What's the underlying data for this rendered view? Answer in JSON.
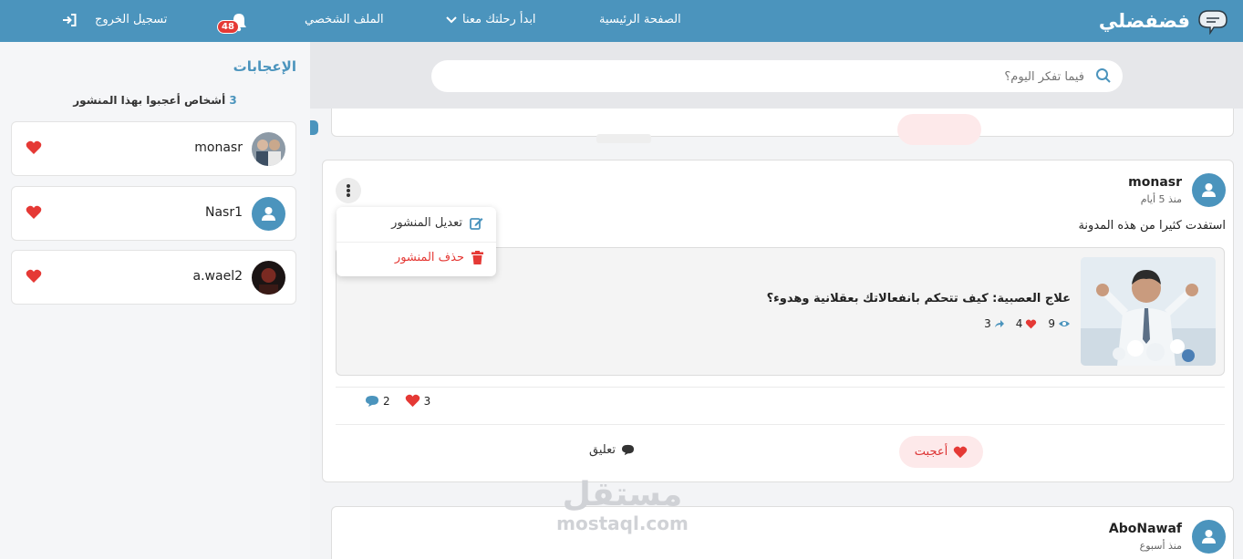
{
  "colors": {
    "brand": "#4b94bd",
    "danger": "#e53935",
    "like_bg": "#fde9ea"
  },
  "header": {
    "brand": "فضفضلي",
    "nav": [
      "الصفحة الرئيسية",
      "ابدأ رحلتك معنا",
      "الملف الشخصي"
    ],
    "notifications_count": "48",
    "logout": "تسجيل الخروج"
  },
  "likes_panel": {
    "title": "الإعجابات",
    "count": "3",
    "count_text": "أشخاص أعجبوا بهذا المنشور",
    "users": [
      {
        "name": "monasr",
        "avatar": "photo"
      },
      {
        "name": "Nasr1",
        "avatar": "default"
      },
      {
        "name": "a.wael2",
        "avatar": "photo"
      }
    ]
  },
  "search": {
    "placeholder": "فيما تفكر اليوم؟"
  },
  "post": {
    "user": "monasr",
    "time": "منذ 5 أيام",
    "text": "استفدت كثيرا من هذه المدونة",
    "menu": {
      "edit": "تعديل المنشور",
      "delete": "حذف المنشور"
    },
    "link": {
      "title": "علاج العصبية: كيف تتحكم بانفعالاتك بعقلانية وهدوء؟",
      "views": "9",
      "likes": "4",
      "shares": "3"
    },
    "likes_count": "3",
    "comments_count": "2",
    "like_label": "أعجبت",
    "comment_label": "تعليق"
  },
  "next_post": {
    "user": "AboNawaf",
    "time": "منذ أسبوع"
  },
  "watermark": {
    "arabic": "مستقل",
    "latin": "mostaql.com"
  }
}
